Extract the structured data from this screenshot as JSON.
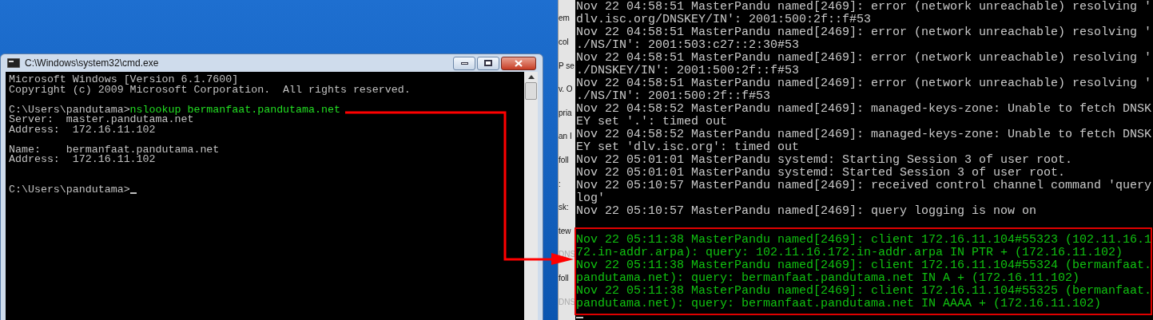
{
  "cmd_window": {
    "title": "C:\\Windows\\system32\\cmd.exe",
    "lines": [
      {
        "kind": "output",
        "text": "Microsoft Windows [Version 6.1.7600]"
      },
      {
        "kind": "output",
        "text": "Copyright (c) 2009 Microsoft Corporation.  All rights reserved."
      },
      {
        "kind": "blank"
      },
      {
        "kind": "command",
        "prompt": "C:\\Users\\pandutama>",
        "command": "nslookup bermanfaat.pandutama.net"
      },
      {
        "kind": "output",
        "text": "Server:  master.pandutama.net"
      },
      {
        "kind": "output",
        "text": "Address:  172.16.11.102"
      },
      {
        "kind": "blank"
      },
      {
        "kind": "output",
        "text": "Name:    bermanfaat.pandutama.net"
      },
      {
        "kind": "output",
        "text": "Address:  172.16.11.102"
      },
      {
        "kind": "blank"
      },
      {
        "kind": "blank"
      },
      {
        "kind": "prompt",
        "prompt": "C:\\Users\\pandutama>",
        "cursor": true
      }
    ]
  },
  "background_window": {
    "fragments": [
      {
        "text": "em",
        "dim": false
      },
      {
        "text": "col",
        "dim": false
      },
      {
        "text": "P se",
        "dim": false
      },
      {
        "text": "v. O",
        "dim": false
      },
      {
        "text": "pria",
        "dim": false
      },
      {
        "text": "an I",
        "dim": false
      },
      {
        "text": "foll",
        "dim": false
      },
      {
        "text": ":",
        "dim": false
      },
      {
        "text": "sk:",
        "dim": false
      },
      {
        "text": "tew",
        "dim": false
      },
      {
        "text": "DNS",
        "dim": true
      },
      {
        "text": "foll",
        "dim": false
      },
      {
        "text": "DNS",
        "dim": true
      }
    ]
  },
  "terminal": {
    "log_lines": [
      "Nov 22 04:58:51 MasterPandu named[2469]: error (network unreachable) resolving 'dlv.isc.org/DNSKEY/IN': 2001:500:2f::f#53",
      "Nov 22 04:58:51 MasterPandu named[2469]: error (network unreachable) resolving './NS/IN': 2001:503:c27::2:30#53",
      "Nov 22 04:58:51 MasterPandu named[2469]: error (network unreachable) resolving './DNSKEY/IN': 2001:500:2f::f#53",
      "Nov 22 04:58:51 MasterPandu named[2469]: error (network unreachable) resolving './NS/IN': 2001:500:2f::f#53",
      "Nov 22 04:58:52 MasterPandu named[2469]: managed-keys-zone: Unable to fetch DNSKEY set '.': timed out",
      "Nov 22 04:58:52 MasterPandu named[2469]: managed-keys-zone: Unable to fetch DNSKEY set 'dlv.isc.org': timed out",
      "Nov 22 05:01:01 MasterPandu systemd: Starting Session 3 of user root.",
      "Nov 22 05:01:01 MasterPandu systemd: Started Session 3 of user root.",
      "Nov 22 05:10:57 MasterPandu named[2469]: received control channel command 'querylog'",
      "Nov 22 05:10:57 MasterPandu named[2469]: query logging is now on"
    ],
    "highlighted_lines": [
      "Nov 22 05:11:38 MasterPandu named[2469]: client 172.16.11.104#55323 (102.11.16.172.in-addr.arpa): query: 102.11.16.172.in-addr.arpa IN PTR + (172.16.11.102)",
      "Nov 22 05:11:38 MasterPandu named[2469]: client 172.16.11.104#55324 (bermanfaat.pandutama.net): query: bermanfaat.pandutama.net IN A + (172.16.11.102)",
      "Nov 22 05:11:38 MasterPandu named[2469]: client 172.16.11.104#55325 (bermanfaat.pandutama.net): query: bermanfaat.pandutama.net IN AAAA + (172.16.11.102)"
    ],
    "cursor": true
  }
}
